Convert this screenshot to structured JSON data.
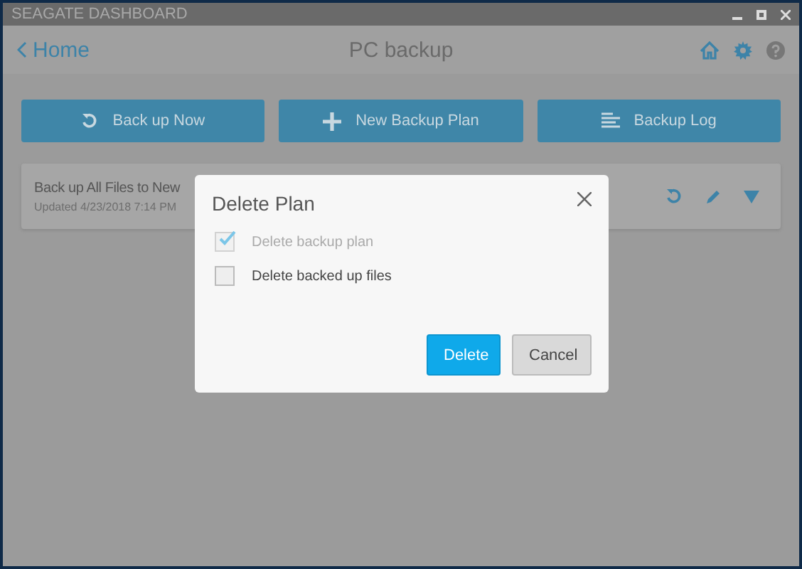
{
  "window": {
    "title": "SEAGATE DASHBOARD"
  },
  "header": {
    "back_link": "Home",
    "title": "PC backup"
  },
  "actions": [
    {
      "label": "Back up Now",
      "kind": "backup"
    },
    {
      "label": "New Backup Plan",
      "kind": "new"
    },
    {
      "label": "Backup Log",
      "kind": "log"
    }
  ],
  "plans": [
    {
      "name": "Back up All Files to New",
      "updated": "Updated 4/23/2018 7:14 PM"
    }
  ],
  "dialog": {
    "title": "Delete Plan",
    "options": [
      {
        "label": "Delete backup plan",
        "checked": true,
        "disabled": true
      },
      {
        "label": "Delete backed up files",
        "checked": false,
        "disabled": false
      }
    ],
    "buttons": [
      {
        "label": "Delete",
        "kind": "primary"
      },
      {
        "label": "Cancel",
        "kind": "secondary"
      }
    ]
  }
}
